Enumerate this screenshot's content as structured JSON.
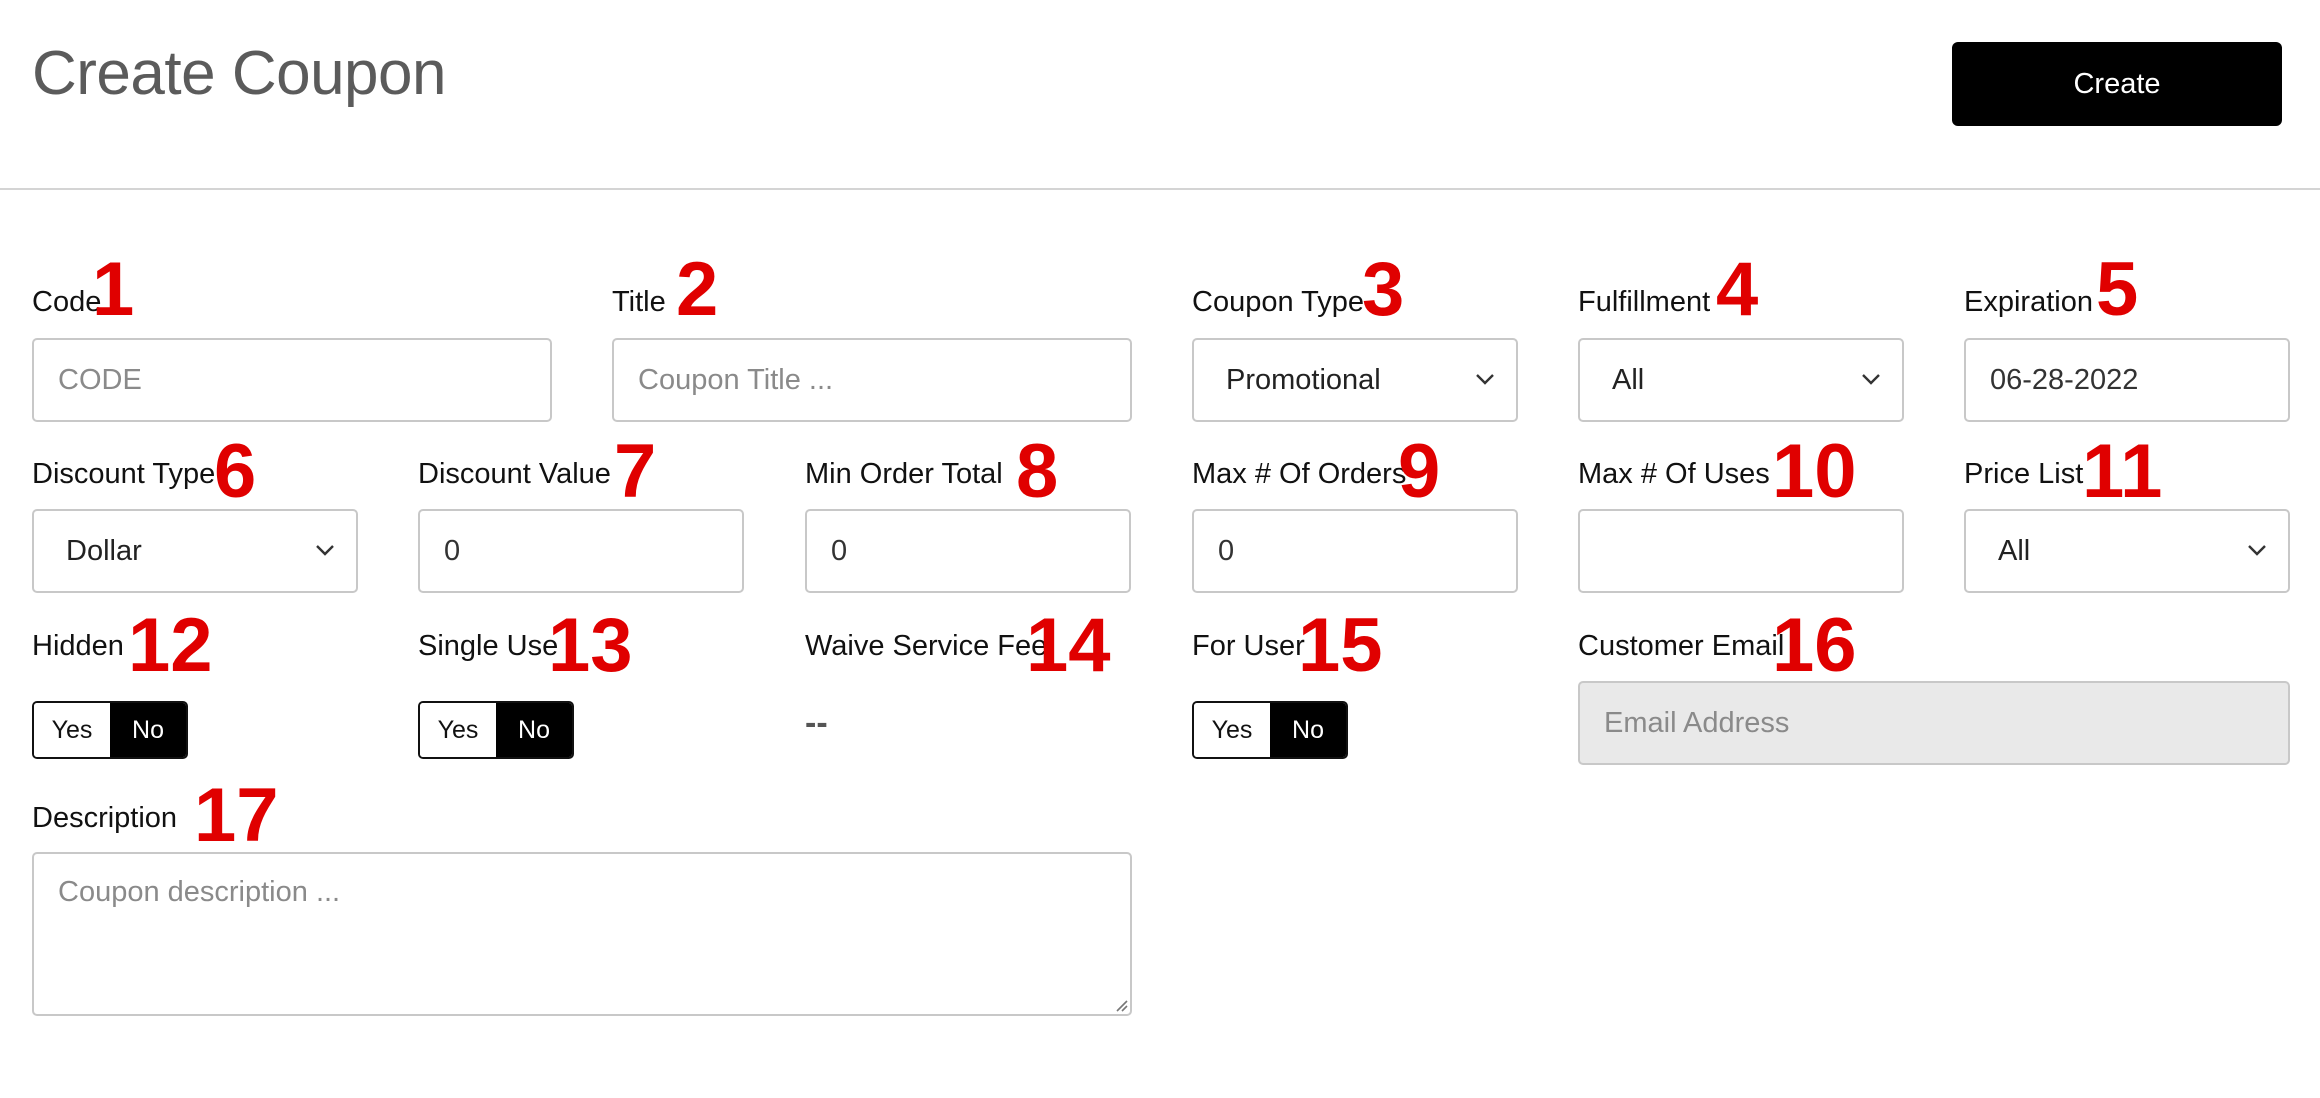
{
  "header": {
    "title": "Create Coupon",
    "create_label": "Create"
  },
  "fields": {
    "code": {
      "label": "Code",
      "marker": "1",
      "placeholder": "CODE",
      "value": ""
    },
    "title": {
      "label": "Title",
      "marker": "2",
      "placeholder": "Coupon Title ...",
      "value": ""
    },
    "coupon_type": {
      "label": "Coupon Type",
      "marker": "3",
      "selected": "Promotional"
    },
    "fulfillment": {
      "label": "Fulfillment",
      "marker": "4",
      "selected": "All"
    },
    "expiration": {
      "label": "Expiration",
      "marker": "5",
      "value": "06-28-2022"
    },
    "discount_type": {
      "label": "Discount Type",
      "marker": "6",
      "selected": "Dollar"
    },
    "discount_value": {
      "label": "Discount Value",
      "marker": "7",
      "value": "0"
    },
    "min_order_total": {
      "label": "Min Order Total",
      "marker": "8",
      "value": "0"
    },
    "max_orders": {
      "label": "Max # Of Orders",
      "marker": "9",
      "value": "0"
    },
    "max_uses": {
      "label": "Max # Of Uses",
      "marker": "10",
      "value": ""
    },
    "price_list": {
      "label": "Price List",
      "marker": "11",
      "selected": "All"
    },
    "hidden": {
      "label": "Hidden",
      "marker": "12",
      "yes": "Yes",
      "no": "No",
      "selected": "No"
    },
    "single_use": {
      "label": "Single Use",
      "marker": "13",
      "yes": "Yes",
      "no": "No",
      "selected": "No"
    },
    "waive_service_fee": {
      "label": "Waive Service Fee",
      "marker": "14",
      "value": "--"
    },
    "for_user": {
      "label": "For User",
      "marker": "15",
      "yes": "Yes",
      "no": "No",
      "selected": "No"
    },
    "customer_email": {
      "label": "Customer Email",
      "marker": "16",
      "placeholder": "Email Address",
      "value": ""
    },
    "description": {
      "label": "Description",
      "marker": "17",
      "placeholder": "Coupon description ...",
      "value": ""
    }
  },
  "colors": {
    "marker": "#e00000",
    "button_bg": "#000000",
    "toggle_active": "#000000",
    "disabled_field": "#e9e9e9",
    "border": "#c8c8c8"
  },
  "icons": {
    "select_arrow": "chevron-down-icon",
    "resize": "resize-grip-icon"
  }
}
